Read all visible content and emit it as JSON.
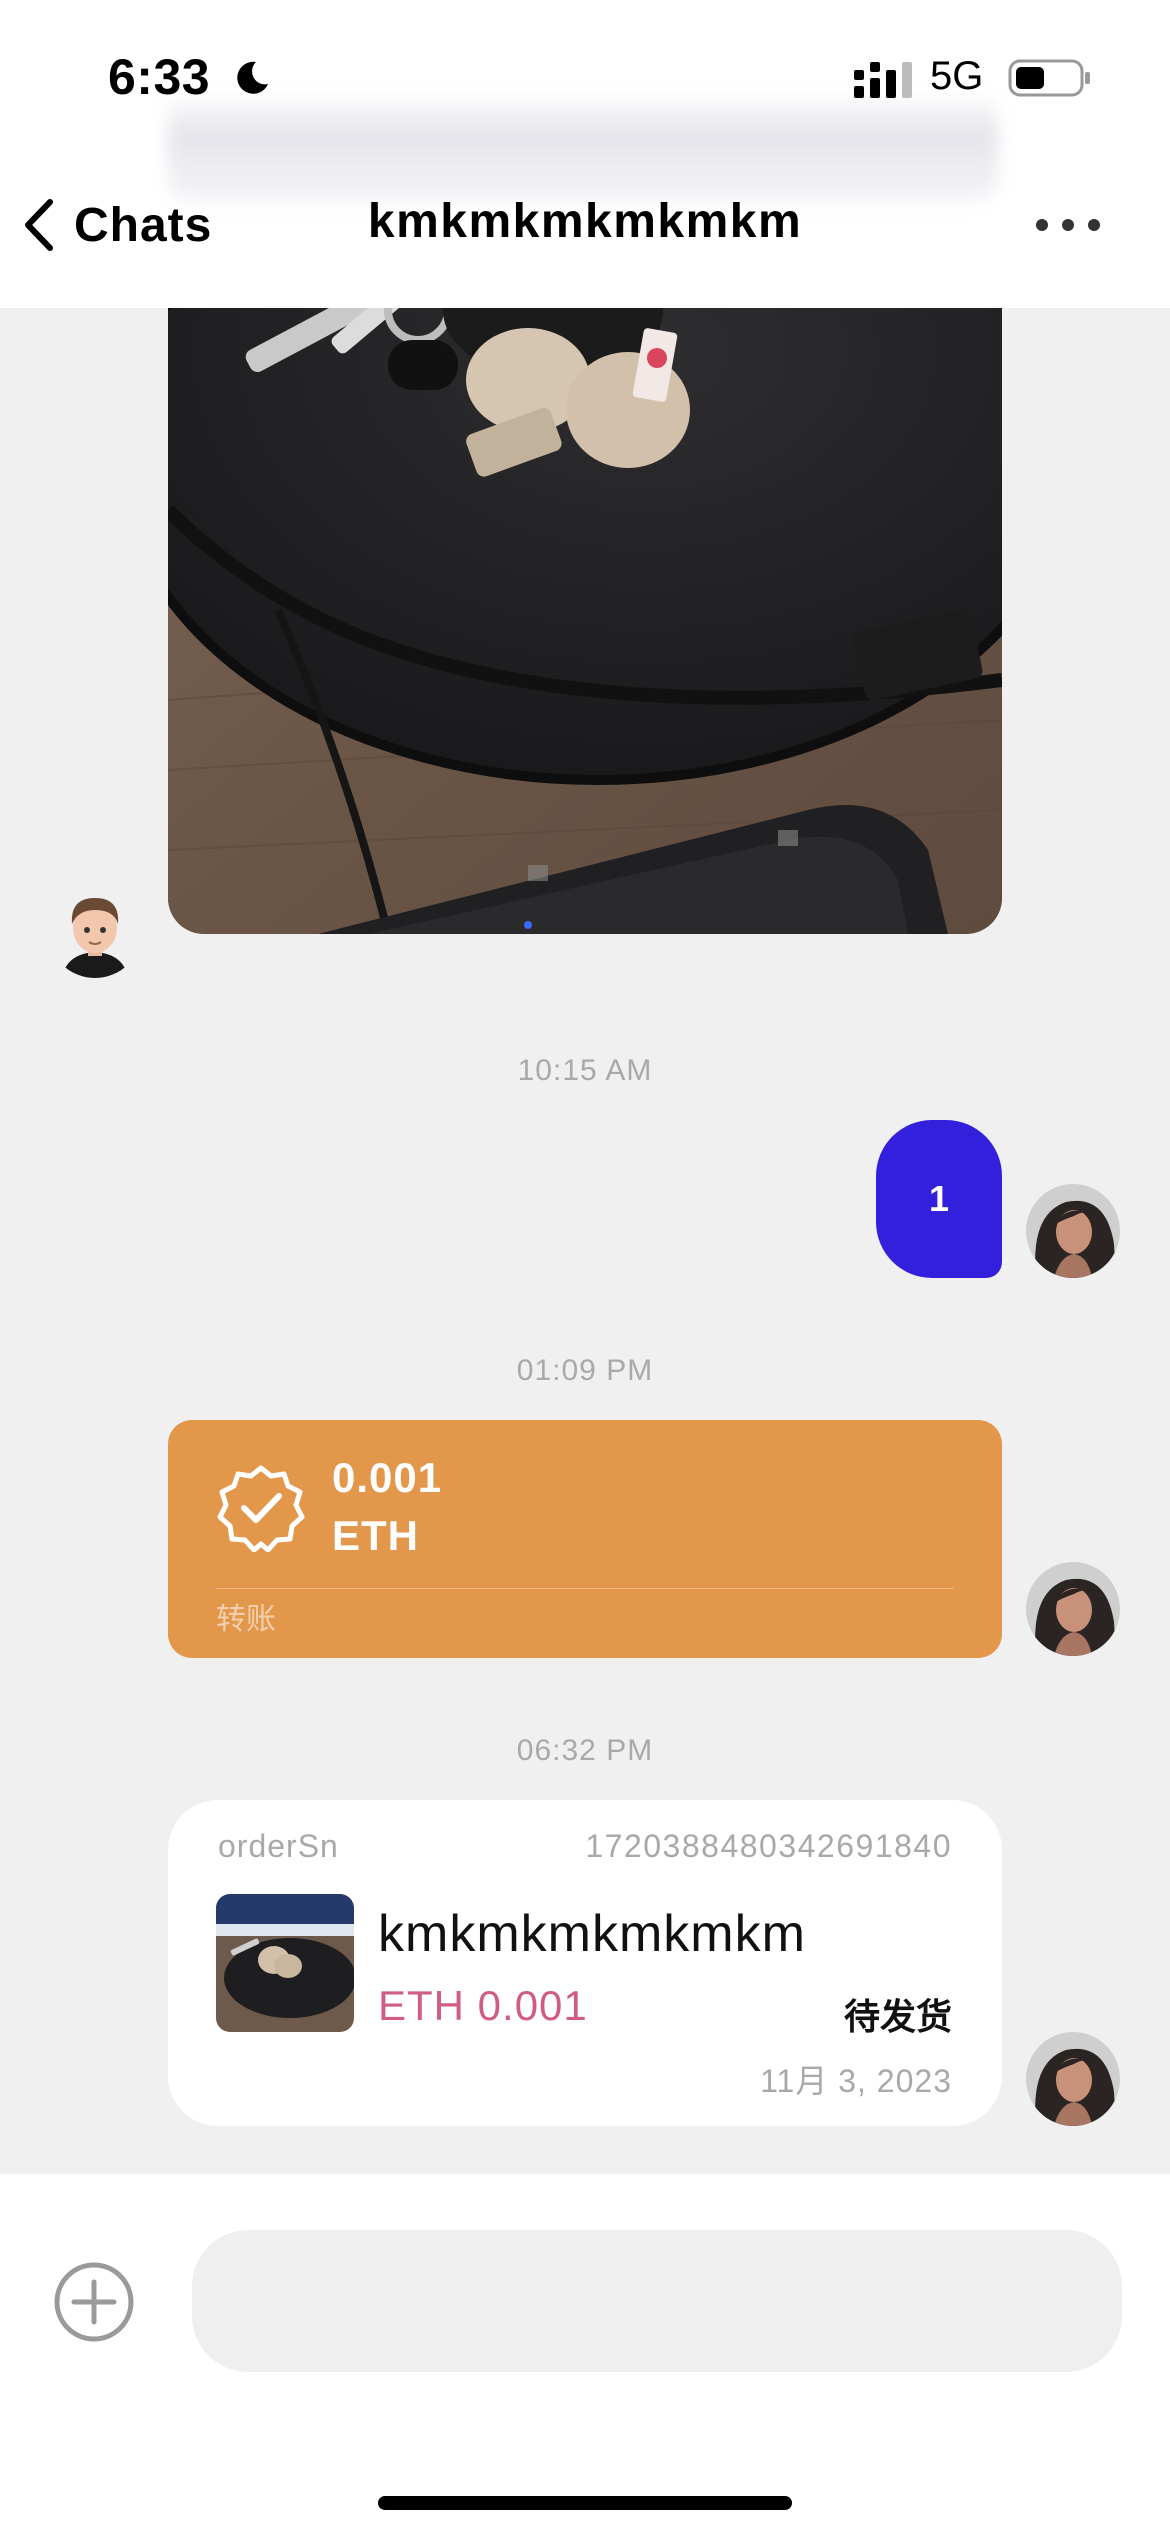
{
  "status_bar": {
    "time": "6:33",
    "network": "5G",
    "icons": [
      "moon-icon",
      "signal-icon",
      "battery-icon"
    ]
  },
  "header": {
    "back_label": "Chats",
    "title": "kmkmkmkmkmkm",
    "more_icon": "ellipsis-icon"
  },
  "messages": {
    "timestamp_1": "10:15 AM",
    "text_1": "1",
    "timestamp_2": "01:09 PM",
    "transfer": {
      "amount": "0.001",
      "currency": "ETH",
      "label": "转账"
    },
    "timestamp_3": "06:32 PM",
    "order": {
      "sn_label": "orderSn",
      "sn_value": "1720388480342691840",
      "name": "kmkmkmkmkmkm",
      "price": "ETH 0.001",
      "status": "待发货",
      "date": "11月 3, 2023"
    }
  },
  "composer": {
    "placeholder": "",
    "add_icon": "plus-circle-icon"
  },
  "colors": {
    "accent_blue": "#3320dc",
    "transfer_orange": "#e3974b",
    "price_pink": "#d05c84",
    "background": "#f0f0f0"
  }
}
